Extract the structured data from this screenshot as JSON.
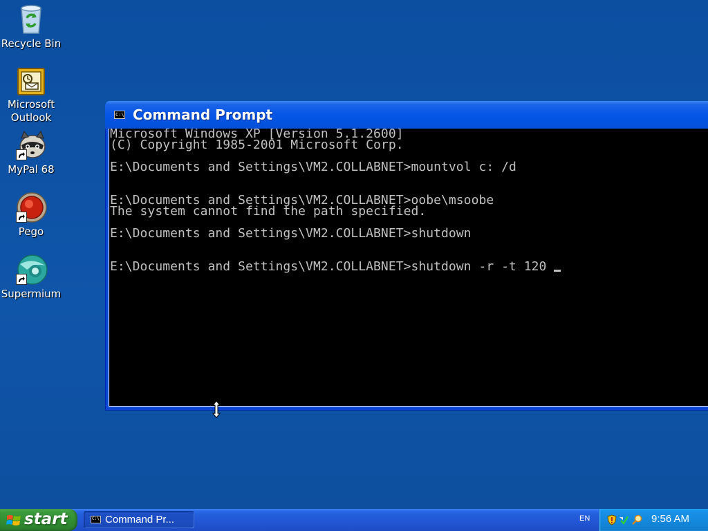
{
  "desktop": {
    "icons": [
      {
        "label": "Recycle Bin",
        "icon": "recycle-bin-icon"
      },
      {
        "label": "Microsoft Outlook",
        "icon": "outlook-icon"
      },
      {
        "label": "MyPal 68",
        "icon": "mypal-icon"
      },
      {
        "label": "Pego",
        "icon": "pego-icon"
      },
      {
        "label": "Supermium",
        "icon": "supermium-icon"
      }
    ]
  },
  "window": {
    "title": "Command Prompt",
    "console_lines": [
      "Microsoft Windows XP [Version 5.1.2600]",
      "(C) Copyright 1985-2001 Microsoft Corp.",
      "",
      "E:\\Documents and Settings\\VM2.COLLABNET>mountvol c: /d",
      "",
      "",
      "E:\\Documents and Settings\\VM2.COLLABNET>oobe\\msoobe",
      "The system cannot find the path specified.",
      "",
      "E:\\Documents and Settings\\VM2.COLLABNET>shutdown",
      "",
      "",
      "E:\\Documents and Settings\\VM2.COLLABNET>shutdown -r -t 120 "
    ]
  },
  "taskbar": {
    "start_label": "start",
    "task_button_label": "Command Pr...",
    "language": "EN",
    "clock": "9:56 AM"
  },
  "colors": {
    "desktop": "#0f51a4",
    "console_bg": "#000000",
    "console_text": "#c0c0c0",
    "titlebar": "#0858e8",
    "start_green": "#328f32",
    "tray_blue": "#1387db"
  }
}
